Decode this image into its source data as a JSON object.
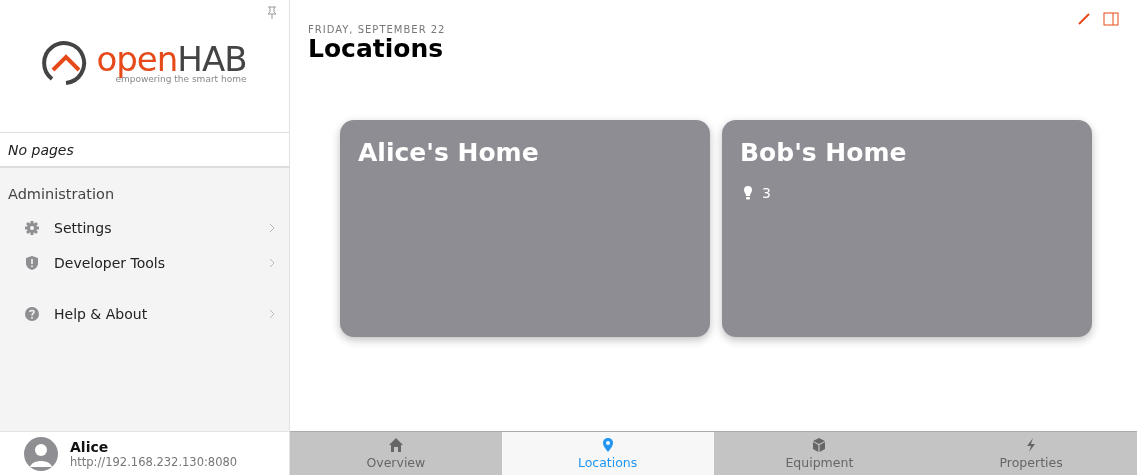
{
  "logo": {
    "word_open": "open",
    "word_hab": "HAB",
    "tagline": "empowering the smart home"
  },
  "pages_note": "No pages",
  "admin": {
    "heading": "Administration",
    "items": [
      {
        "label": "Settings",
        "kind": "gear"
      },
      {
        "label": "Developer Tools",
        "kind": "shield"
      }
    ]
  },
  "help": {
    "label": "Help & About",
    "kind": "help"
  },
  "user": {
    "name": "Alice",
    "server": "http://192.168.232.130:8080"
  },
  "header": {
    "date": "FRIDAY, SEPTEMBER 22",
    "title": "Locations"
  },
  "cards": [
    {
      "title": "Alice's Home"
    },
    {
      "title": "Bob's Home",
      "badges": [
        {
          "kind": "light",
          "count": "3"
        }
      ]
    }
  ],
  "tabs": [
    {
      "label": "Overview",
      "kind": "home",
      "selected": false
    },
    {
      "label": "Locations",
      "kind": "pin",
      "selected": true
    },
    {
      "label": "Equipment",
      "kind": "box",
      "selected": false
    },
    {
      "label": "Properties",
      "kind": "bolt",
      "selected": false
    }
  ]
}
